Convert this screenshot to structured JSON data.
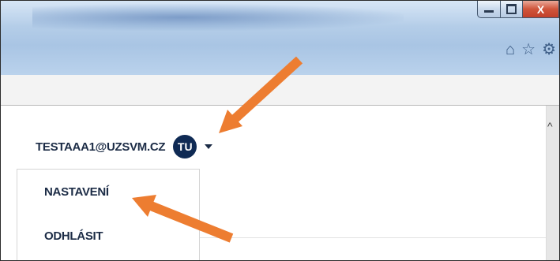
{
  "window": {
    "close_glyph": "X"
  },
  "toolbar_icons": [
    {
      "icon": "home-icon",
      "glyph": "⌂"
    },
    {
      "icon": "star-icon",
      "glyph": "☆"
    },
    {
      "icon": "gear-icon",
      "glyph": "⚙"
    }
  ],
  "user": {
    "email": "TESTAAA1@UZSVM.CZ",
    "initials": "TU"
  },
  "user_menu": {
    "items": [
      {
        "label": "NASTAVENÍ"
      },
      {
        "label": "ODHLÁSIT"
      }
    ]
  },
  "colors": {
    "accent_arrow": "#ed7d31",
    "avatar_bg": "#0f2a54",
    "text": "#1c2c46"
  }
}
